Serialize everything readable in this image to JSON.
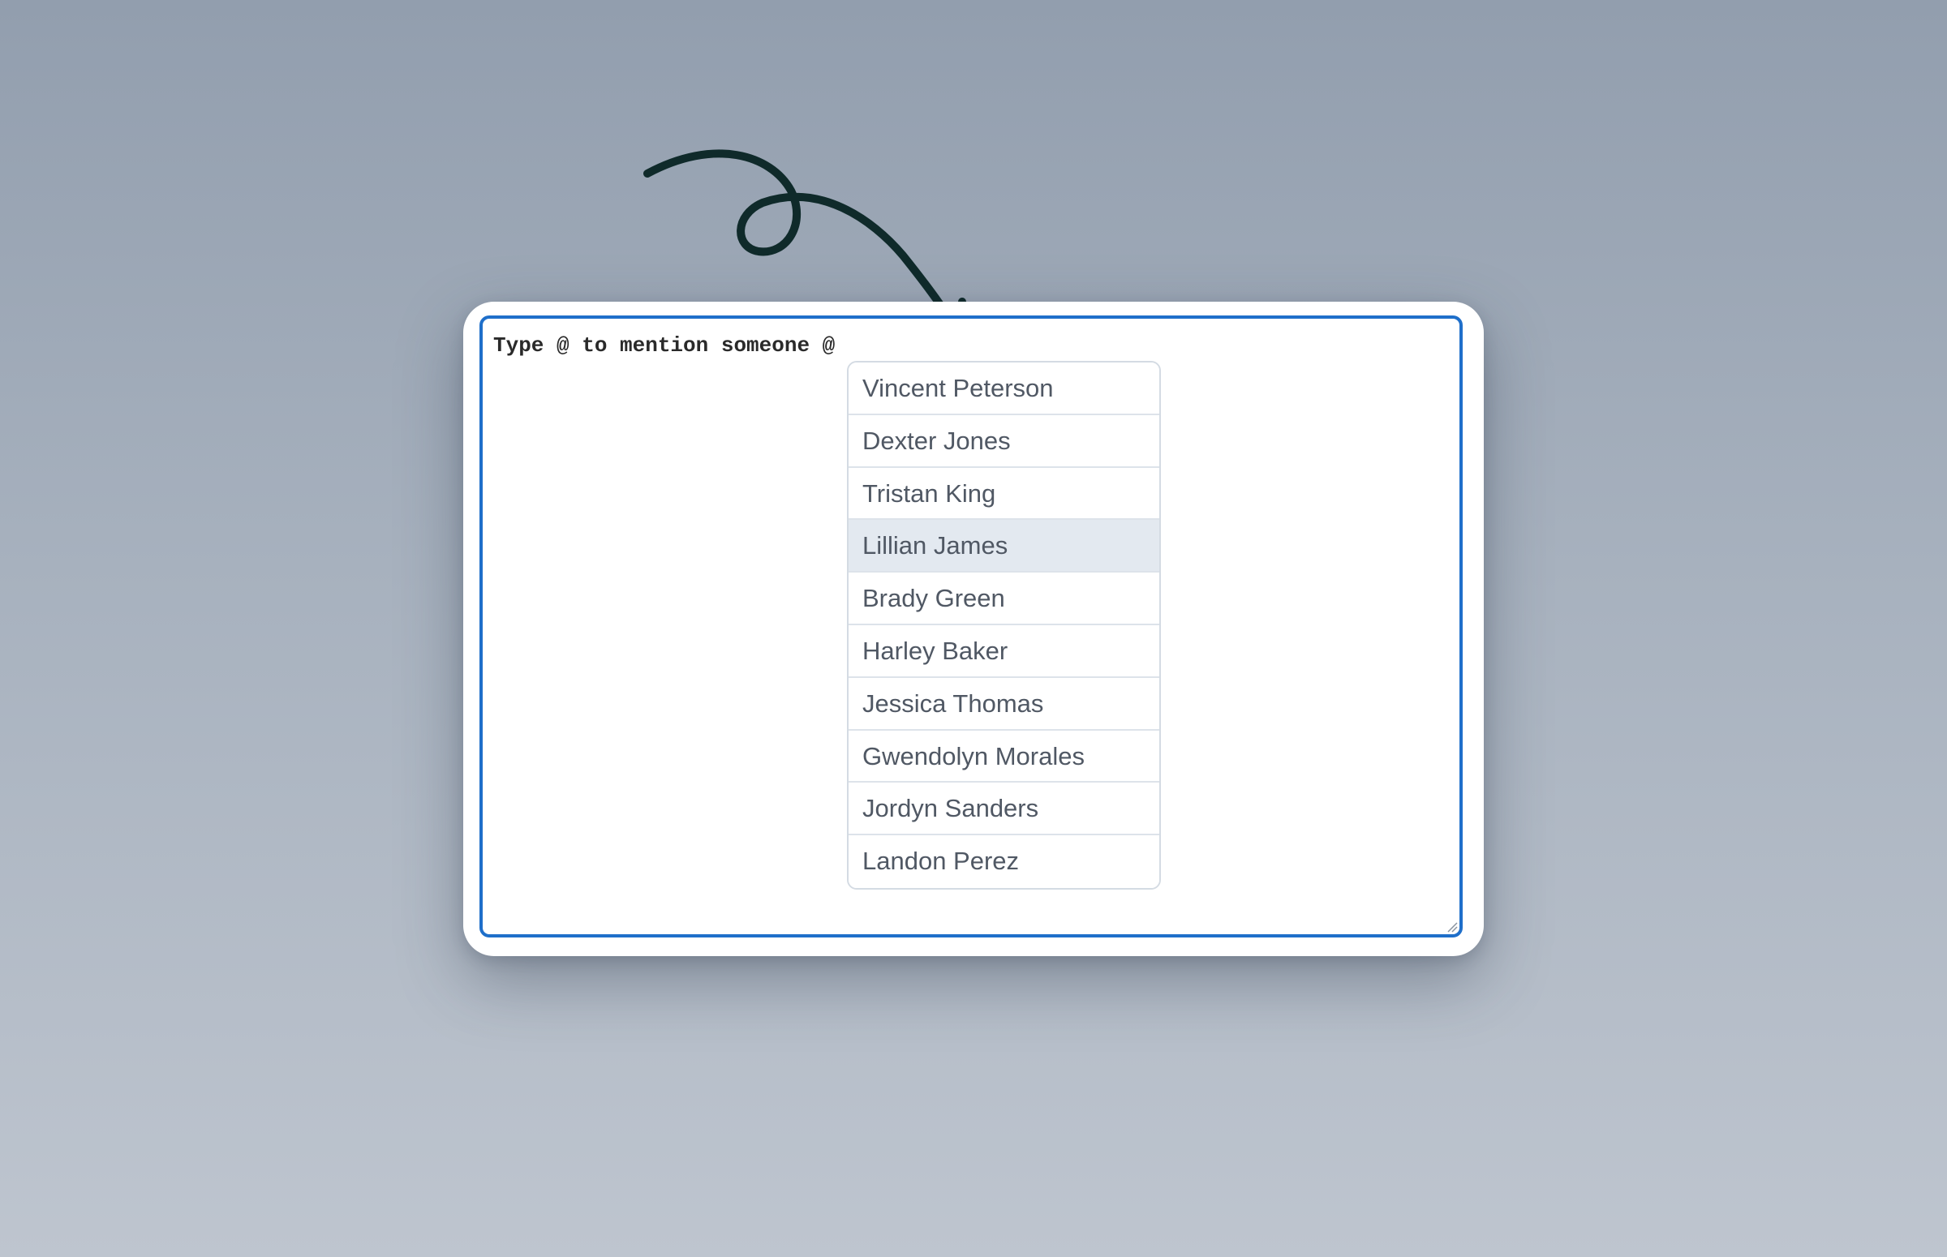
{
  "editor": {
    "text": "Type @ to mention someone @"
  },
  "suggestions": [
    {
      "label": "Vincent Peterson",
      "highlighted": false
    },
    {
      "label": "Dexter Jones",
      "highlighted": false
    },
    {
      "label": "Tristan King",
      "highlighted": false
    },
    {
      "label": "Lillian James",
      "highlighted": true
    },
    {
      "label": "Brady Green",
      "highlighted": false
    },
    {
      "label": "Harley Baker",
      "highlighted": false
    },
    {
      "label": "Jessica Thomas",
      "highlighted": false
    },
    {
      "label": "Gwendolyn Morales",
      "highlighted": false
    },
    {
      "label": "Jordyn Sanders",
      "highlighted": false
    },
    {
      "label": "Landon Perez",
      "highlighted": false
    }
  ],
  "colors": {
    "focus_border": "#1f6fca",
    "highlight_bg": "#e3e9f0",
    "arrow": "#0f2a2a"
  },
  "icons": {
    "annotation": "curly-arrow-icon",
    "resize": "resize-handle-icon"
  }
}
